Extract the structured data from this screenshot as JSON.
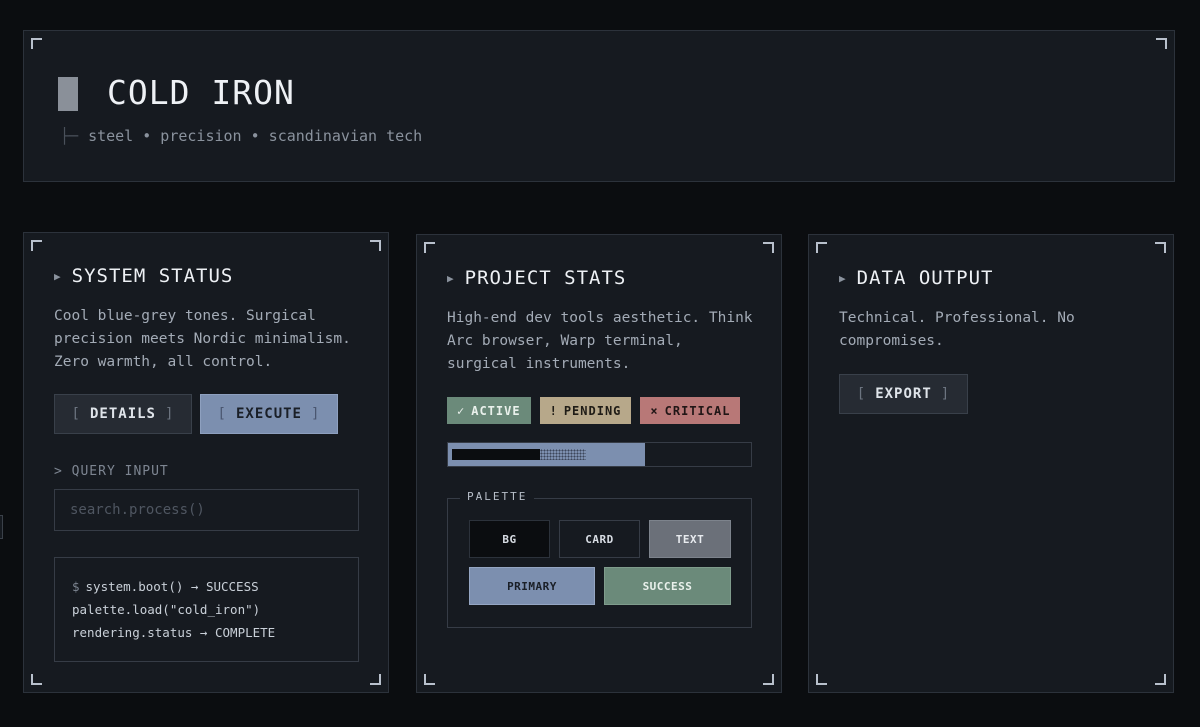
{
  "header": {
    "title": "COLD IRON",
    "subtitle_branch": "├─",
    "subtitle": "steel • precision • scandinavian tech"
  },
  "status_card": {
    "title": "SYSTEM STATUS",
    "description": "Cool blue-grey tones. Surgical precision meets Nordic minimalism. Zero warmth, all control.",
    "buttons": {
      "details_label": "DETAILS",
      "execute_label": "EXECUTE",
      "bracket_open": "[",
      "bracket_close": "]"
    },
    "query_label": "> QUERY INPUT",
    "query_input": {
      "value": "",
      "placeholder": "search.process()"
    },
    "terminal": {
      "prompt": "$",
      "lines": [
        "system.boot() → SUCCESS",
        "palette.load(\"cold_iron\")",
        "rendering.status → COMPLETE"
      ]
    }
  },
  "stats_card": {
    "title": "PROJECT STATS",
    "description": "High-end dev tools aesthetic. Think Arc browser, Warp terminal, surgical instruments.",
    "badges": {
      "active": {
        "symbol": "✓",
        "label": "ACTIVE"
      },
      "pending": {
        "symbol": "!",
        "label": "PENDING"
      },
      "critical": {
        "symbol": "×",
        "label": "CRITICAL"
      }
    },
    "progress": {
      "value": 0.65
    },
    "palette": {
      "label": "PALETTE",
      "swatches": {
        "bg": "BG",
        "card": "CARD",
        "text": "TEXT",
        "primary": "PRIMARY",
        "success": "SUCCESS"
      }
    }
  },
  "output_card": {
    "title": "DATA OUTPUT",
    "description": "Technical. Professional. No compromises.",
    "export_label": "EXPORT"
  },
  "colors": {
    "background": "#0b0d10",
    "card": "#161a20",
    "text": "#6b7079",
    "primary": "#7c8faf",
    "success": "#6b8a7a",
    "pending": "#b7a88a",
    "critical": "#b87877"
  }
}
